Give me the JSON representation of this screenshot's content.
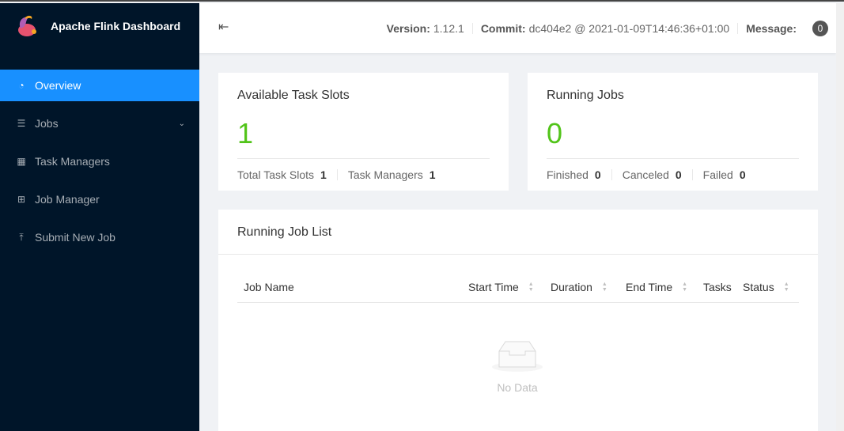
{
  "app": {
    "title": "Apache Flink Dashboard"
  },
  "sidebar": {
    "items": [
      {
        "label": "Overview"
      },
      {
        "label": "Jobs"
      },
      {
        "label": "Task Managers"
      },
      {
        "label": "Job Manager"
      },
      {
        "label": "Submit New Job"
      }
    ]
  },
  "header": {
    "version_label": "Version:",
    "version": "1.12.1",
    "commit_label": "Commit:",
    "commit": "dc404e2 @ 2021-01-09T14:46:36+01:00",
    "message_label": "Message:",
    "message_count": "0"
  },
  "slots": {
    "title": "Available Task Slots",
    "value": "1",
    "total_label": "Total Task Slots",
    "total": "1",
    "tm_label": "Task Managers",
    "tm": "1"
  },
  "running": {
    "title": "Running Jobs",
    "value": "0",
    "finished_label": "Finished",
    "finished": "0",
    "canceled_label": "Canceled",
    "canceled": "0",
    "failed_label": "Failed",
    "failed": "0"
  },
  "joblist": {
    "title": "Running Job List",
    "columns": [
      "Job Name",
      "Start Time",
      "Duration",
      "End Time",
      "Tasks",
      "Status"
    ],
    "empty": "No Data"
  },
  "colors": {
    "accent": "#1890ff",
    "sidebar": "#001529",
    "success": "#52c41a"
  }
}
